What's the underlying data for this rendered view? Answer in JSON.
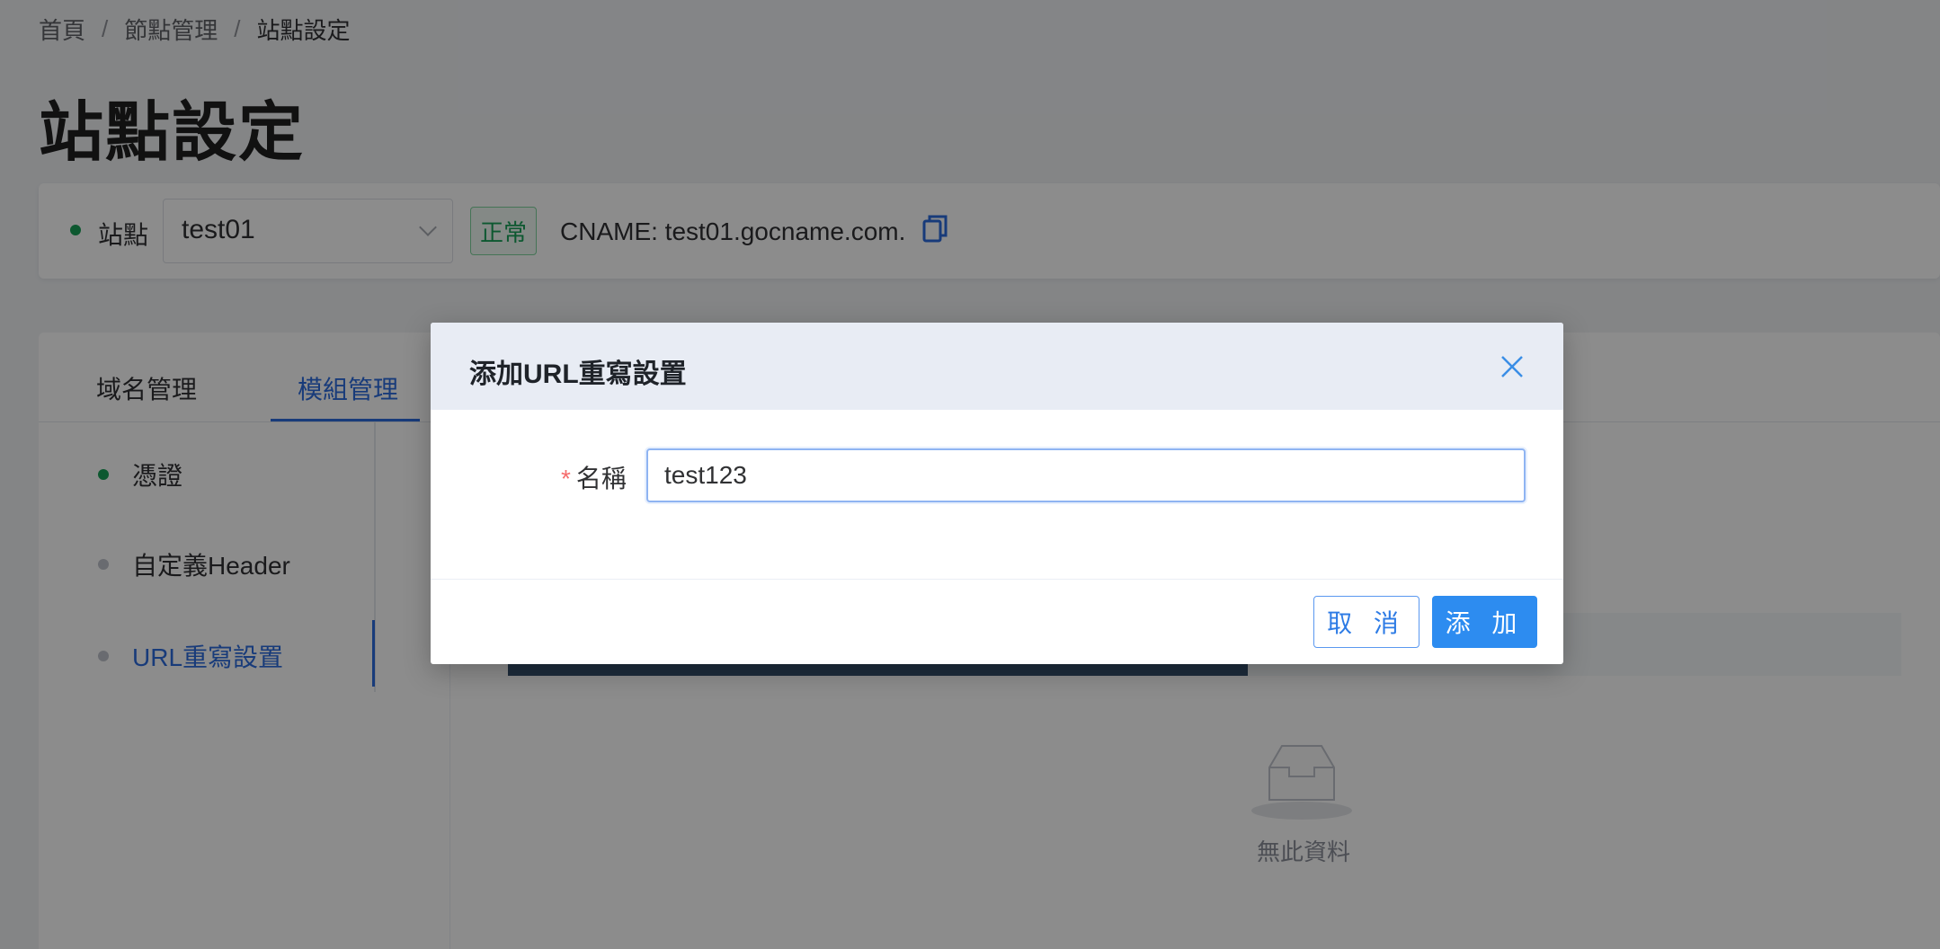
{
  "breadcrumb": {
    "items": [
      "首頁",
      "節點管理",
      "站點設定"
    ],
    "separator": "/"
  },
  "page_title": "站點設定",
  "site_bar": {
    "label": "站點",
    "selected_site": "test01",
    "status": "正常",
    "cname": "CNAME: test01.gocname.com."
  },
  "tabs": [
    {
      "label": "域名管理",
      "active": false
    },
    {
      "label": "模組管理",
      "active": true
    }
  ],
  "side_nav": [
    {
      "label": "憑證",
      "status": "green"
    },
    {
      "label": "自定義Header",
      "status": "gray"
    },
    {
      "label": "URL重寫設置",
      "status": "gray",
      "active": true
    }
  ],
  "empty_state": {
    "text": "無此資料"
  },
  "dialog": {
    "title": "添加URL重寫設置",
    "required_mark": "*",
    "name_label": "名稱",
    "name_value": "test123",
    "cancel_label": "取 消",
    "add_label": "添 加"
  },
  "colors": {
    "primary": "#2d8cf0",
    "success": "#18a058",
    "danger": "#f56c6c"
  },
  "icons": {
    "copy": "copy-icon",
    "close": "close-icon",
    "chevron": "chevron-down-icon",
    "empty": "empty-inbox-icon"
  }
}
